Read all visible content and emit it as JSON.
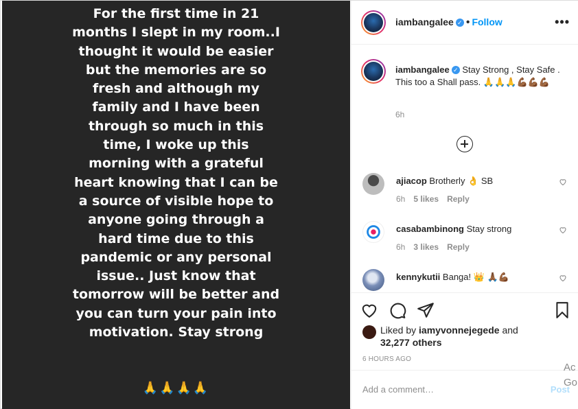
{
  "post": {
    "username": "iambangalee",
    "follow_label": "Follow",
    "more_label": "•••",
    "story_text": "For the first time in 21 months I slept in my room..I thought it would be easier but the memories are so fresh and although my family and I have been through so much in this time, I woke up this morning with a grateful heart knowing that I can be a source of visible hope to anyone going through a hard time due to this pandemic or any personal issue.. Just know that tomorrow will be better and you can turn your pain into motivation. Stay strong",
    "story_emoji": "🙏🙏🙏🙏"
  },
  "caption": {
    "username": "iambangalee",
    "text": "Stay Strong , Stay Safe . This too a Shall pass. 🙏🙏🙏💪🏾💪🏾💪🏾",
    "time": "6h"
  },
  "comments": [
    {
      "username": "ajiacop",
      "text": "Brotherly 👌 SB",
      "time": "6h",
      "likes": "5 likes",
      "reply": "Reply",
      "avatar_color": "#9a9a9a"
    },
    {
      "username": "casabambinong",
      "text": "Stay strong",
      "time": "6h",
      "likes": "3 likes",
      "reply": "Reply",
      "avatar_color": "#ffffff"
    },
    {
      "username": "kennykutii",
      "text": "Banga! 👑 🙏🏾💪🏾",
      "avatar_color": "#7b8fb8"
    }
  ],
  "likes": {
    "prefix": "Liked by",
    "user": "iamyvonnejegede",
    "middle": "and",
    "count": "32,277 others"
  },
  "post_time": "6 HOURS AGO",
  "add_comment": {
    "placeholder": "Add a comment…",
    "post_label": "Post"
  },
  "activate_overlay": "Ac\nGo",
  "colors": {
    "link_blue": "#0095f6",
    "verified_blue": "#3897f0",
    "muted": "#8e8e8e"
  }
}
